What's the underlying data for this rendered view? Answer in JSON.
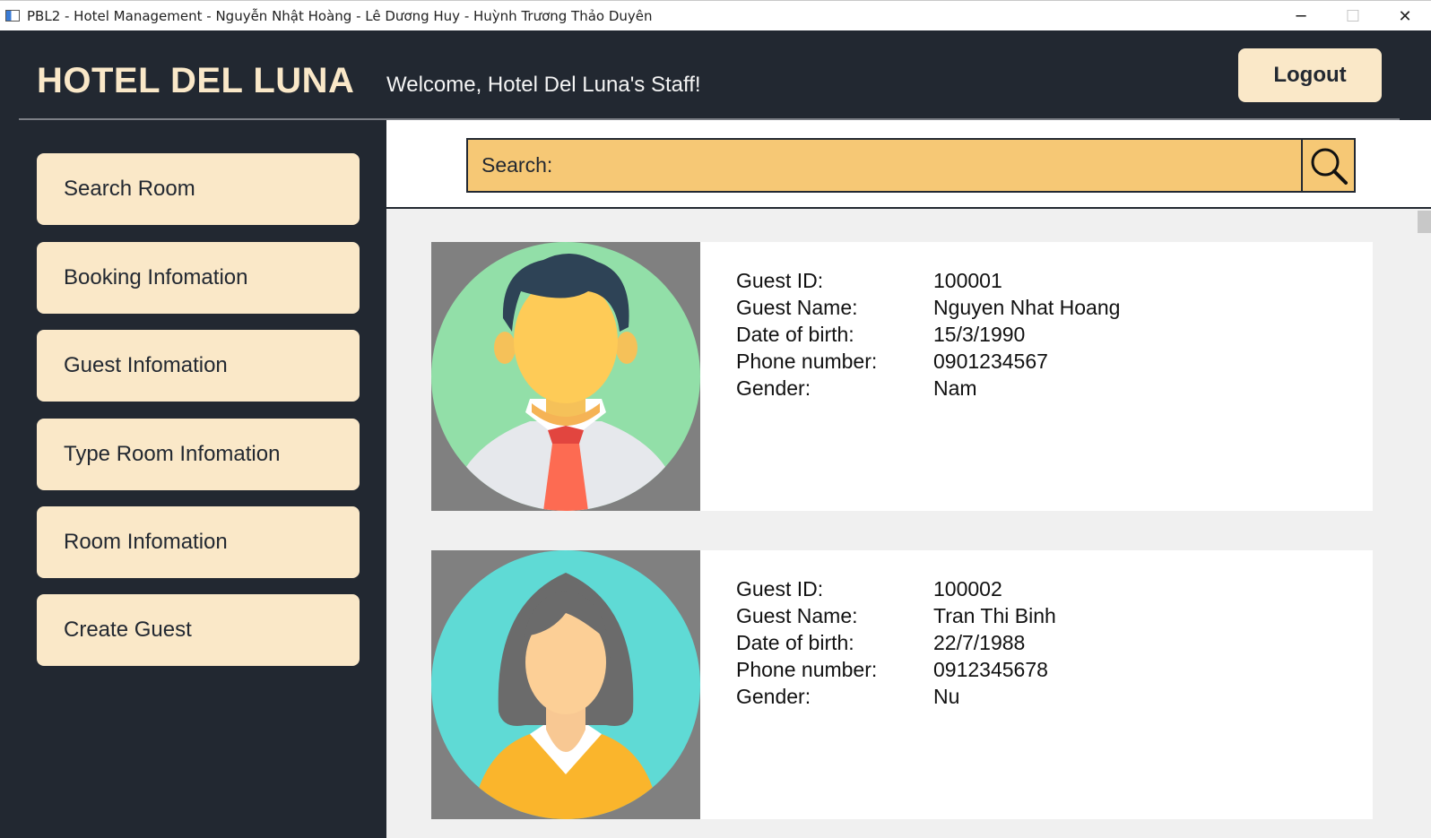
{
  "window": {
    "title": "PBL2 - Hotel Management - Nguyễn Nhật Hoàng - Lê Dương Huy - Huỳnh Trương Thảo Duyên",
    "minimize": "─",
    "maximize": "☐",
    "close": "✕"
  },
  "header": {
    "brand": "HOTEL DEL LUNA",
    "welcome": "Welcome, Hotel Del Luna's Staff!",
    "logout_label": "Logout"
  },
  "sidebar": {
    "items": [
      {
        "label": "Search Room"
      },
      {
        "label": "Booking Infomation"
      },
      {
        "label": "Guest Infomation"
      },
      {
        "label": "Type Room Infomation"
      },
      {
        "label": "Room Infomation"
      },
      {
        "label": "Create Guest"
      }
    ]
  },
  "search": {
    "label": "Search:",
    "icon": "search-icon"
  },
  "fields": {
    "id": "Guest ID:",
    "name": "Guest Name:",
    "dob": "Date of birth:",
    "phone": "Phone number:",
    "gender": "Gender:"
  },
  "guests": [
    {
      "id": "100001",
      "name": "Nguyen Nhat Hoang",
      "dob": "15/3/1990",
      "phone": "0901234567",
      "gender": "Nam",
      "avatar": "male-avatar-icon"
    },
    {
      "id": "100002",
      "name": "Tran Thi Binh",
      "dob": "22/7/1988",
      "phone": "0912345678",
      "gender": "Nu",
      "avatar": "female-avatar-icon"
    }
  ],
  "colors": {
    "dark": "#222831",
    "cream": "#fae8c8",
    "search_bg": "#f6c875",
    "male_bg": "#92dfa8",
    "female_bg": "#5fdad5"
  }
}
